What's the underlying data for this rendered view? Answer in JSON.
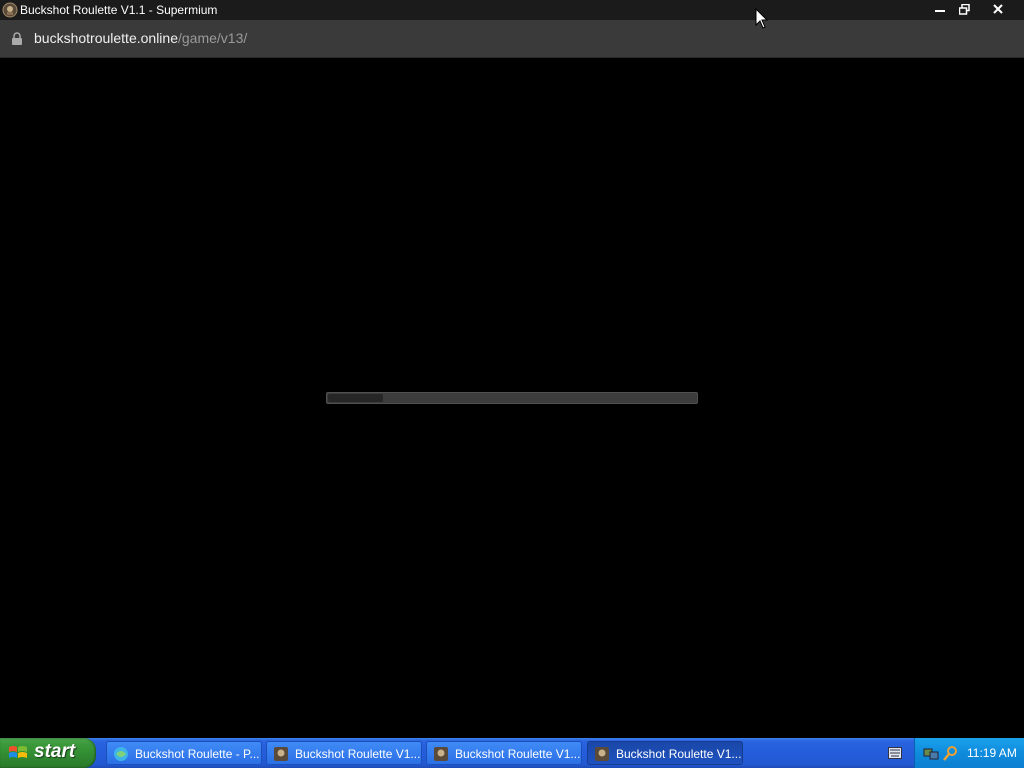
{
  "window": {
    "title": "Buckshot Roulette V1.1 - Supermium",
    "icon": "buckshot-app-icon"
  },
  "address_bar": {
    "domain": "buckshotroulette.online",
    "path": "/game/v13/"
  },
  "game": {
    "loading_progress": 0.15
  },
  "taskbar": {
    "start_label": "start",
    "tasks": [
      {
        "label": "Buckshot Roulette - P...",
        "icon": "browser-icon",
        "active": false
      },
      {
        "label": "Buckshot Roulette V1...",
        "icon": "buckshot-app-icon",
        "active": false
      },
      {
        "label": "Buckshot Roulette V1...",
        "icon": "buckshot-app-icon",
        "active": false
      },
      {
        "label": "Buckshot Roulette V1...",
        "icon": "buckshot-app-icon",
        "active": true
      }
    ],
    "clock": "11:19 AM"
  },
  "colors": {
    "taskbar_blue": "#245ddb",
    "start_green": "#3b9a3b",
    "tray_blue": "#0f8bdc"
  }
}
